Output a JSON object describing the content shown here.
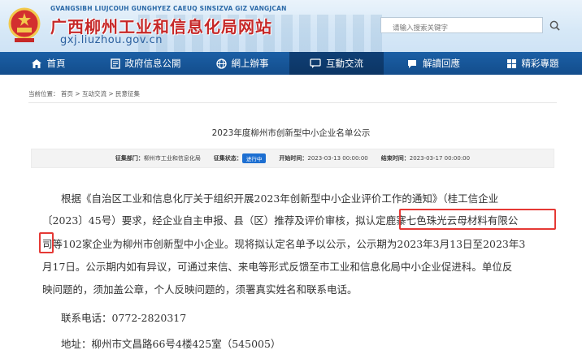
{
  "header": {
    "site_subtitle": "GVANGSIBH LIUJCOUH GUNGHYEZ CAEUQ SINSIZVA GIZ VANGJCAN",
    "site_title": "广西柳州工业和信息化局网站",
    "site_url": "gxj.liuzhou.gov.cn",
    "search_placeholder": "请输入搜索关键字"
  },
  "nav": {
    "items": [
      {
        "label": "首頁",
        "icon": "home-icon"
      },
      {
        "label": "政府信息公開",
        "icon": "document-icon"
      },
      {
        "label": "網上辦事",
        "icon": "globe-icon"
      },
      {
        "label": "互動交流",
        "icon": "chat-icon"
      },
      {
        "label": "解讀回應",
        "icon": "bubble-icon"
      },
      {
        "label": "精彩專題",
        "icon": "puzzle-icon"
      }
    ],
    "active_index": 3
  },
  "breadcrumb": {
    "label": "当前位置：",
    "items": [
      "首页",
      "互动交流",
      "民意征集"
    ],
    "separator": ">"
  },
  "article": {
    "title": "2023年度柳州市创新型中小企业名单公示",
    "meta": {
      "dept_label": "征集部门：",
      "dept_value": "柳州市工业和信息化局",
      "status_label": "征集状态：",
      "status_value": "进行中",
      "start_label": "开始时间：",
      "start_value": "2023-03-13 00:00:00",
      "end_label": "结束时间：",
      "end_value": "2023-03-17 00:00:00"
    },
    "para_line1": "根据《自治区工业和信息化厅关于组织开展2023年创新型中小企业评价工作的通知》（桂工信企业",
    "para_line2a": "〔2023〕45号）要求，经企业自主申报、县（区）推荐及评价审核，拟认定",
    "para_line2b": "鹿寨七色珠光云母材料有限公",
    "para_line3a": "司",
    "para_line3b": "等102家企业为柳州市创新型中小企业。现将拟认定名单予以公示，公示期为2023年3月13日至2023年3",
    "para_line4": "月17日。公示期内如有异议，可通过来信、来电等形式反馈至市工业和信息化局中小企业促进科。单位反",
    "para_line5": "映问题的，须加盖公章，个人反映问题的，须署真实姓名和联系电话。",
    "contact_phone": "联系电话：0772-2820317",
    "contact_address": "地址：柳州市文昌路66号4楼425室（545005）"
  },
  "colors": {
    "nav_bg": "#1b5fa5",
    "nav_active": "#0f3f75",
    "title_red": "#c62828",
    "badge_blue": "#1d6fd1",
    "highlight_red": "#e53935"
  }
}
